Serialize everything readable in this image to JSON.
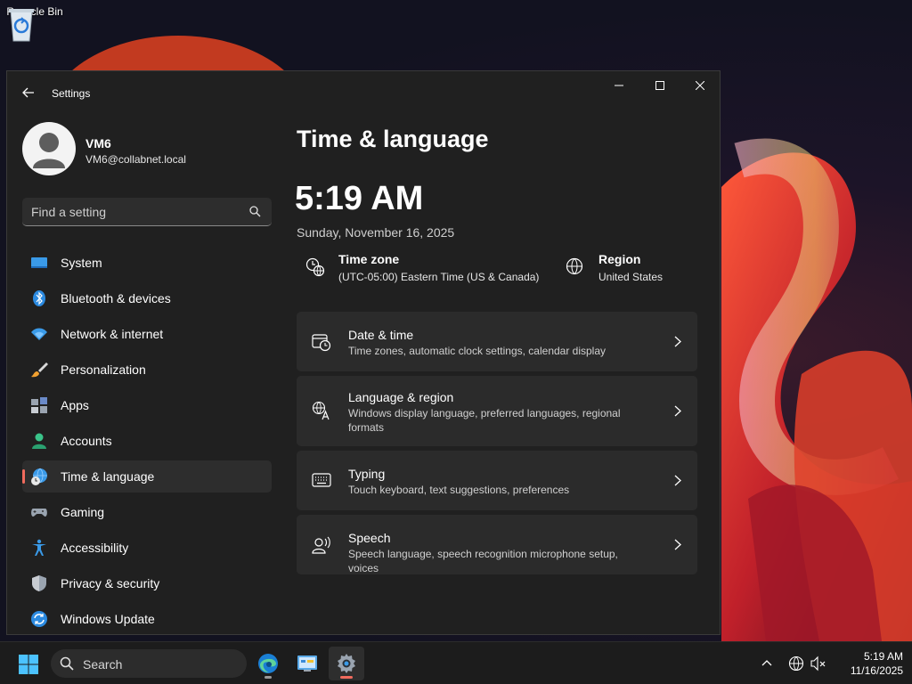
{
  "desktop": {
    "icons": [
      {
        "label": "Recycle Bin",
        "icon": "recycle-bin-icon"
      }
    ]
  },
  "window": {
    "title": "Settings",
    "controls": {
      "minimize": "minimize-icon",
      "maximize": "maximize-icon",
      "close": "close-icon"
    }
  },
  "profile": {
    "name": "VM6",
    "email": "VM6@collabnet.local"
  },
  "search": {
    "placeholder": "Find a setting"
  },
  "sidebar": {
    "items": [
      {
        "label": "System",
        "icon": "system-icon"
      },
      {
        "label": "Bluetooth & devices",
        "icon": "bluetooth-icon"
      },
      {
        "label": "Network & internet",
        "icon": "wifi-icon"
      },
      {
        "label": "Personalization",
        "icon": "paintbrush-icon"
      },
      {
        "label": "Apps",
        "icon": "apps-icon"
      },
      {
        "label": "Accounts",
        "icon": "accounts-icon"
      },
      {
        "label": "Time & language",
        "icon": "time-language-icon",
        "selected": true
      },
      {
        "label": "Gaming",
        "icon": "gamepad-icon"
      },
      {
        "label": "Accessibility",
        "icon": "accessibility-icon"
      },
      {
        "label": "Privacy & security",
        "icon": "shield-icon"
      },
      {
        "label": "Windows Update",
        "icon": "update-icon"
      }
    ]
  },
  "main": {
    "title": "Time & language",
    "time": "5:19 AM",
    "date": "Sunday, November 16, 2025",
    "timezone": {
      "title": "Time zone",
      "value": "(UTC-05:00) Eastern Time (US & Canada)"
    },
    "region": {
      "title": "Region",
      "value": "United States"
    },
    "cards": [
      {
        "title": "Date & time",
        "description": "Time zones, automatic clock settings, calendar display",
        "icon": "calendar-clock-icon"
      },
      {
        "title": "Language & region",
        "description": "Windows display language, preferred languages, regional formats",
        "icon": "language-icon"
      },
      {
        "title": "Typing",
        "description": "Touch keyboard, text suggestions, preferences",
        "icon": "keyboard-icon"
      },
      {
        "title": "Speech",
        "description": "Speech language, speech recognition microphone setup, voices",
        "icon": "speech-icon"
      }
    ]
  },
  "taskbar": {
    "search_label": "Search",
    "apps": [
      "edge-icon",
      "control-panel-icon",
      "settings-icon"
    ],
    "tray": [
      "chevron-up-icon",
      "network-globe-icon",
      "speaker-muted-icon"
    ],
    "clock": {
      "time": "5:19 AM",
      "date": "11/16/2025"
    }
  },
  "colors": {
    "accent": "#f06a5d",
    "window_bg": "#202020",
    "card_bg": "#2b2b2b"
  }
}
